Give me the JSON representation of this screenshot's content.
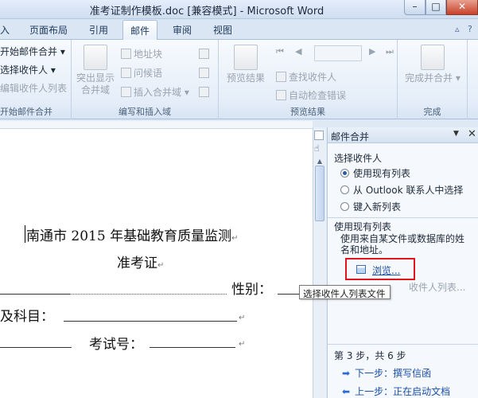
{
  "window": {
    "title": "准考证制作模板.doc [兼容模式] - Microsoft Word",
    "minimize": "–",
    "maximize": "□",
    "close": "✕"
  },
  "tabs": [
    "入",
    "页面布局",
    "引用",
    "邮件",
    "审阅",
    "视图"
  ],
  "active_tab": "邮件",
  "ribbon": {
    "start_group": {
      "items": [
        "开始邮件合并 ▾",
        "选择收件人 ▾",
        "编辑收件人列表"
      ],
      "label": "开始邮件合并"
    },
    "write_group": {
      "highlight_fields_line1": "突出显示",
      "highlight_fields_line2": "合并域",
      "address_block": "地址块",
      "greeting_line": "问候语",
      "insert_merge_field": "插入合并域 ▾",
      "label": "编写和插入域"
    },
    "preview_group": {
      "preview_results": "预览结果",
      "find_recipient": "查找收件人",
      "auto_check": "自动检查错误",
      "label": "预览结果"
    },
    "finish_group": {
      "finish_merge": "完成并合并 ▾",
      "label": "完成"
    }
  },
  "document": {
    "heading": "南通市 2015 年基础教育质量监测",
    "subheading": "准考证",
    "gender_label": "性别：",
    "subject_label": "及科目：",
    "exam_no_label": "考试号：",
    "para_mark": "↵"
  },
  "tooltip": "选择收件人列表文件",
  "task_pane": {
    "title": "邮件合并",
    "dropdown": "▼",
    "close": "✕",
    "section_select": "选择收件人",
    "options": [
      {
        "label": "使用现有列表",
        "selected": true
      },
      {
        "label": "从 Outlook 联系人中选择",
        "selected": false
      },
      {
        "label": "键入新列表",
        "selected": false
      }
    ],
    "section_existing": "使用现有列表",
    "description": "使用来自某文件或数据库的姓名和地址。",
    "browse": "浏览...",
    "edit_list": "收件人列表...",
    "step": "第 3 步，共 6 步",
    "next": "下一步：撰写信函",
    "prev": "上一步：正在启动文档"
  }
}
